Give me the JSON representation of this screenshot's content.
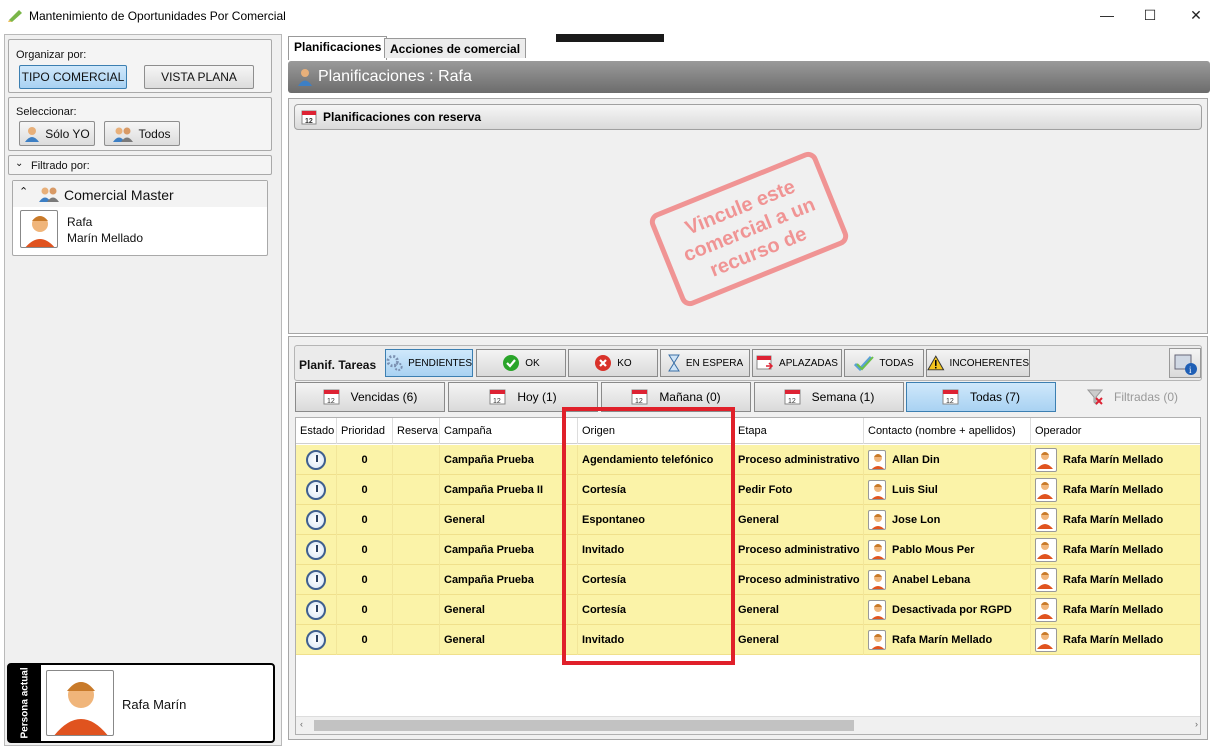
{
  "window": {
    "title": "Mantenimiento de Oportunidades Por Comercial",
    "minimize": "—",
    "maximize": "☐",
    "close": "✕"
  },
  "left": {
    "organize_label": "Organizar por:",
    "btn_tipo": "TIPO COMERCIAL",
    "btn_plana": "VISTA PLANA",
    "select_label": "Seleccionar:",
    "btn_solo": "Sólo YO",
    "btn_todos": "Todos",
    "filter_label": "Filtrado por:",
    "group_title": "Comercial Master",
    "person_first": "Rafa",
    "person_last": "Marín Mellado",
    "current_label": "Persona actual",
    "current_name": "Rafa Marín"
  },
  "tabs": [
    "Planificaciones",
    "Acciones de comercial"
  ],
  "header": "Planificaciones : Rafa",
  "panel_title": "Planificaciones con reserva",
  "stamp_text": "Vincule este comercial a un recurso de",
  "tasks": {
    "label": "Planif. Tareas",
    "status_buttons": [
      "PENDIENTES",
      "OK",
      "KO",
      "EN ESPERA",
      "APLAZADAS",
      "TODAS",
      "INCOHERENTES"
    ],
    "filters": [
      "Vencidas (6)",
      "Hoy (1)",
      "Mañana (0)",
      "Semana (1)",
      "Todas (7)",
      "Filtradas (0)"
    ]
  },
  "grid": {
    "columns": [
      "Estado",
      "Prioridad",
      "Reserva",
      "Campaña",
      "Origen",
      "Etapa",
      "Contacto (nombre + apellidos)",
      "Operador"
    ],
    "rows": [
      {
        "prioridad": "0",
        "campana": "Campaña Prueba",
        "origen": "Agendamiento telefónico",
        "etapa": "Proceso administrativo i",
        "contacto": "Allan Din",
        "operador": "Rafa Marín Mellado"
      },
      {
        "prioridad": "0",
        "campana": "Campaña Prueba II",
        "origen": "Cortesía",
        "etapa": "Pedir Foto",
        "contacto": "Luis Siul",
        "operador": "Rafa Marín Mellado"
      },
      {
        "prioridad": "0",
        "campana": "General",
        "origen": "Espontaneo",
        "etapa": "General",
        "contacto": "Jose Lon",
        "operador": "Rafa Marín Mellado"
      },
      {
        "prioridad": "0",
        "campana": "Campaña Prueba",
        "origen": "Invitado",
        "etapa": "Proceso administrativo i",
        "contacto": "Pablo Mous Per",
        "operador": "Rafa Marín Mellado"
      },
      {
        "prioridad": "0",
        "campana": "Campaña Prueba",
        "origen": "Cortesía",
        "etapa": "Proceso administrativo i",
        "contacto": "Anabel Lebana",
        "operador": "Rafa Marín Mellado"
      },
      {
        "prioridad": "0",
        "campana": "General",
        "origen": "Cortesía",
        "etapa": "General",
        "contacto": "Desactivada por RGPD",
        "operador": "Rafa Marín Mellado"
      },
      {
        "prioridad": "0",
        "campana": "General",
        "origen": "Invitado",
        "etapa": "General",
        "contacto": "Rafa Marín Mellado",
        "operador": "Rafa Marín Mellado"
      }
    ]
  },
  "colors": {
    "row_bg": "#fbf3a8",
    "highlight": "#e0202a",
    "stamp": "#f08b8b",
    "header_bar": "#7d7d7d"
  }
}
